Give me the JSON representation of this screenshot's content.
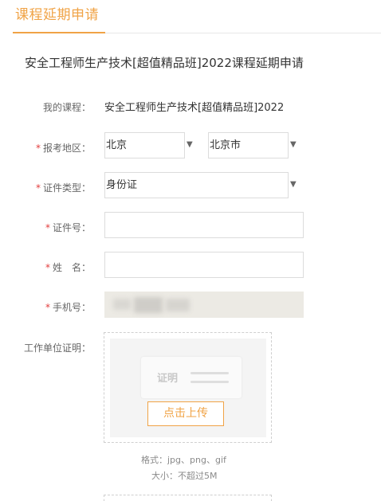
{
  "page": {
    "title": "课程延期申请"
  },
  "form": {
    "heading": "安全工程师生产技术[超值精品班]2022课程延期申请",
    "course": {
      "label": "我的课程：",
      "value": "安全工程师生产技术[超值精品班]2022"
    },
    "region": {
      "required": "*",
      "label": "报考地区：",
      "province": "北京",
      "city": "北京市"
    },
    "id_type": {
      "required": "*",
      "label": "证件类型：",
      "value": "身份证"
    },
    "id_number": {
      "required": "*",
      "label": "证件号：",
      "value": ""
    },
    "name": {
      "required": "*",
      "label": "姓　名：",
      "value": ""
    },
    "phone": {
      "required": "*",
      "label": "手机号："
    },
    "work_proof": {
      "label": "工作单位证明：",
      "placeholder_text": "证明",
      "upload_label": "点击上传",
      "format_hint": "格式：jpg、png、gif",
      "size_hint": "大小：不超过5M"
    }
  },
  "icons": {
    "dropdown": "caret-down-icon"
  },
  "colors": {
    "accent": "#f0a346",
    "required": "#e23d3d",
    "disabled_bg": "#eceae4"
  }
}
